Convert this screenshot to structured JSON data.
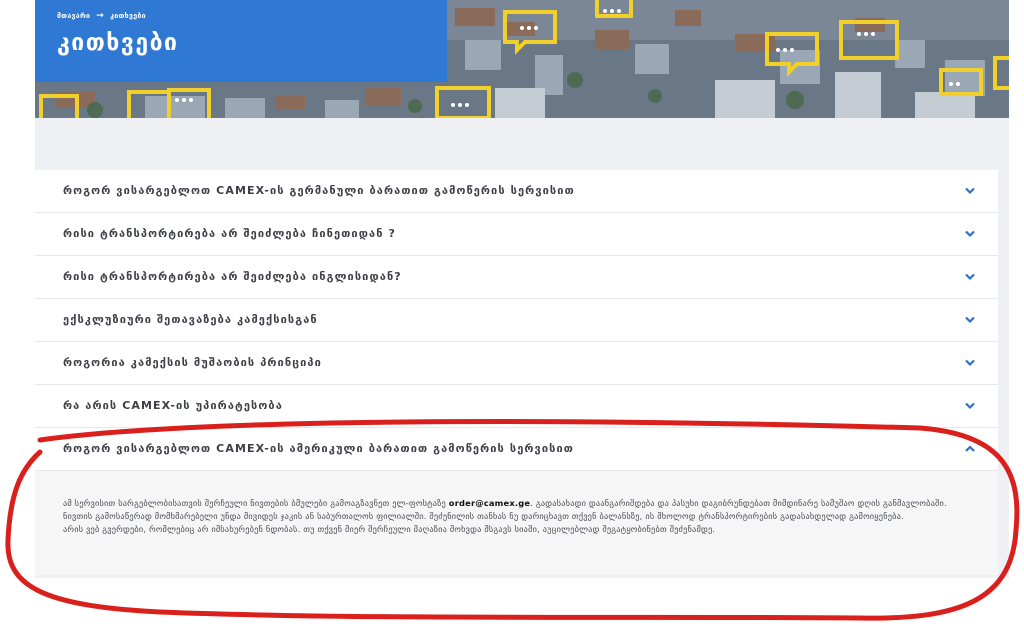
{
  "hero": {
    "breadcrumbs": [
      {
        "label": "მთავარი"
      },
      {
        "label": "კითხვები"
      }
    ],
    "breadcrumb_separator": "→",
    "title": "კითხვები"
  },
  "faq": {
    "items": [
      {
        "question": "როგორ ვისარგებლოთ CAMEX-ის გერმანული ბარათით გამოწერის სერვისით",
        "expanded": false
      },
      {
        "question": "რისი ტრანსპორტირება არ შეიძლება ჩინეთიდან ?",
        "expanded": false
      },
      {
        "question": "რისი ტრანსპორტირება არ შეიძლება ინგლისიდან?",
        "expanded": false
      },
      {
        "question": "ექსკლუზიური შეთავაზება კამექსისგან",
        "expanded": false
      },
      {
        "question": "როგორია კამექსის მუშაობის პრინციპი",
        "expanded": false
      },
      {
        "question": "რა არის CAMEX-ის უპირატესობა",
        "expanded": false
      },
      {
        "question": "როგორ ვისარგებლოთ CAMEX-ის ამერიკული ბარათით გამოწერის სერვისით",
        "expanded": true
      }
    ],
    "answer": {
      "text_before_email": "ამ სერვისით სარგებლობისათვის შერჩეული ნივთების ბმულები გამოაგზავნეთ ელ-ფოსტაზე ",
      "email": "order@camex.ge",
      "text_after_email": ". გადასახადი დაანგარიშდება და პასუხი დაგიბრუნდებათ მიმდინარე სამუშაო დღის განმავლობაში. ნივთის გამოსაწერად მომხმარებელი უნდა მივიდეს ჯაკის ან საბურთალოს ფილიალში. შეძენილის თანხას ნუ დარიცხავთ თქვენ ბალანსზე, ის მხოლოდ ტრანსპორტირების გადასახდელად გამოიყენება.",
      "note": "არის ვებ გვერდები, რომლებიც არ იმსახურებენ ნდობას. თუ თქვენ მიერ შერჩეული მაღაზია მოხვდა მსგავს სიაში, აუცილებლად შეგატყობინებთ შეძენამდე."
    }
  },
  "colors": {
    "hero_panel": "#2f78d3",
    "chevron": "#2f6fc8",
    "annotation": "#d9201c",
    "page_band": "#eef0f3"
  },
  "icons": {
    "collapsed": "chevron-down-icon",
    "expanded": "chevron-up-icon"
  }
}
